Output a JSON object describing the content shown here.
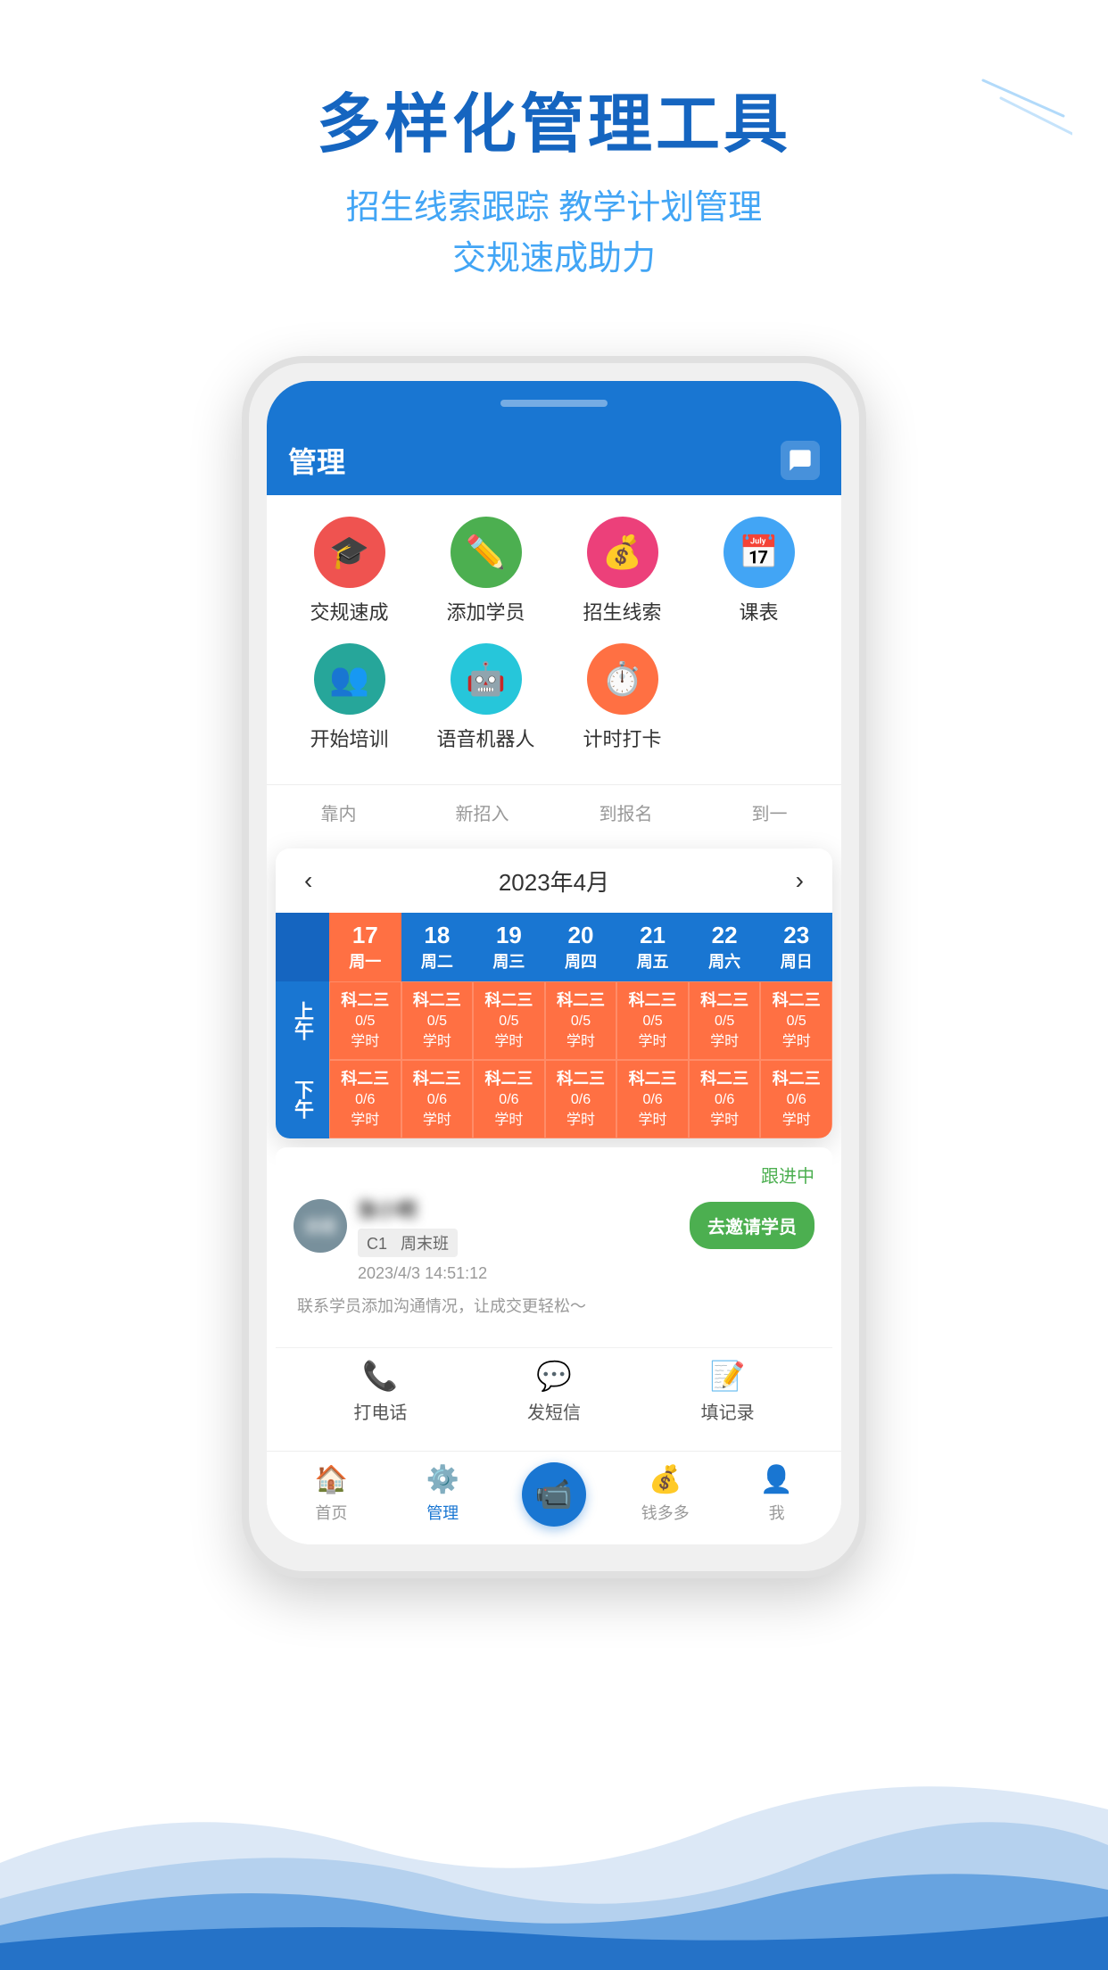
{
  "page": {
    "background": "#ffffff"
  },
  "header": {
    "main_title": "多样化管理工具",
    "sub_title_line1": "招生线索跟踪 教学计划管理",
    "sub_title_line2": "交规速成助力"
  },
  "app": {
    "title": "管理",
    "chat_icon_label": "消息图标"
  },
  "quick_actions": {
    "row1": [
      {
        "label": "交规速成",
        "color": "color-red",
        "icon": "🎓"
      },
      {
        "label": "添加学员",
        "color": "color-green",
        "icon": "✏️"
      },
      {
        "label": "招生线索",
        "color": "color-pink",
        "icon": "💰"
      },
      {
        "label": "课表",
        "color": "color-blue",
        "icon": "📅"
      }
    ],
    "row2": [
      {
        "label": "开始培训",
        "color": "color-green2",
        "icon": "👥"
      },
      {
        "label": "语音机器人",
        "color": "color-teal",
        "icon": "🤖"
      },
      {
        "label": "计时打卡",
        "color": "color-orange",
        "icon": "👥"
      }
    ]
  },
  "tabs": [
    {
      "label": "靠内",
      "active": false
    },
    {
      "label": "新招入",
      "active": false
    },
    {
      "label": "到报名",
      "active": false
    },
    {
      "label": "到一",
      "active": false
    }
  ],
  "calendar": {
    "title": "2023年4月",
    "nav_prev": "‹",
    "nav_next": "›",
    "header_cells": [
      {
        "num": "17",
        "name": "周一",
        "orange": true
      },
      {
        "num": "18",
        "name": "周二",
        "orange": false
      },
      {
        "num": "19",
        "name": "周三",
        "orange": false
      },
      {
        "num": "20",
        "name": "周四",
        "orange": false
      },
      {
        "num": "21",
        "name": "周五",
        "orange": false
      },
      {
        "num": "22",
        "name": "周六",
        "orange": false
      },
      {
        "num": "23",
        "name": "周日",
        "orange": false
      }
    ],
    "morning_label": "上午",
    "afternoon_label": "下午",
    "morning_cells": [
      "科二三\n0/5\n学时",
      "科二三\n0/5\n学时",
      "科二三\n0/5\n学时",
      "科二三\n0/5\n学时",
      "科二三\n0/5\n学时",
      "科二三\n0/5\n学时",
      "科二三\n0/5\n学时"
    ],
    "afternoon_cells": [
      "科二三\n0/6\n学时",
      "科二三\n0/6\n学时",
      "科二三\n0/6\n学时",
      "科二三\n0/6\n学时",
      "科二三\n0/6\n学时",
      "科二三\n0/6\n学时",
      "科二三\n0/6\n学时"
    ]
  },
  "lead_card": {
    "status": "跟进中",
    "avatar_text": "去班",
    "name_blurred": "██████",
    "class_badge": "C1",
    "class_type": "周末班",
    "time": "2023/4/3 14:51:12",
    "invite_btn": "去邀请学员",
    "tip": "联系学员添加沟通情况，让成交更轻松～",
    "action_call": "打电话",
    "action_sms": "发短信",
    "action_record": "填记录"
  },
  "bottom_nav": {
    "items": [
      {
        "label": "首页",
        "icon": "🏠",
        "active": false
      },
      {
        "label": "管理",
        "icon": "⚙️",
        "active": true
      },
      {
        "label": "",
        "icon": "📹",
        "active": false,
        "camera": true
      },
      {
        "label": "钱多多",
        "icon": "💰",
        "active": false
      },
      {
        "label": "我",
        "icon": "👤",
        "active": false
      }
    ]
  }
}
